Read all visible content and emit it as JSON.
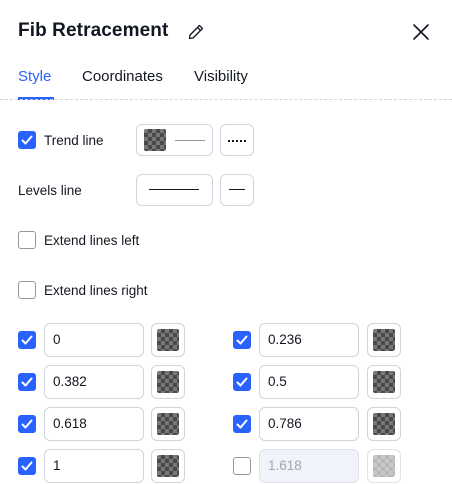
{
  "dialog": {
    "title": "Fib Retracement",
    "tabs": [
      {
        "label": "Style",
        "active": true
      },
      {
        "label": "Coordinates",
        "active": false
      },
      {
        "label": "Visibility",
        "active": false
      }
    ]
  },
  "style": {
    "trend_line": {
      "label": "Trend line",
      "checked": true,
      "color_icon": "checkerboard-swatch",
      "line_style": "solid",
      "line_dash": "dotted"
    },
    "levels_line": {
      "label": "Levels line",
      "line_style": "solid"
    },
    "extend_left": {
      "label": "Extend lines left",
      "checked": false
    },
    "extend_right": {
      "label": "Extend lines right",
      "checked": false
    },
    "levels": [
      {
        "value": "0",
        "checked": true,
        "enabled": true
      },
      {
        "value": "0.236",
        "checked": true,
        "enabled": true
      },
      {
        "value": "0.382",
        "checked": true,
        "enabled": true
      },
      {
        "value": "0.5",
        "checked": true,
        "enabled": true
      },
      {
        "value": "0.618",
        "checked": true,
        "enabled": true
      },
      {
        "value": "0.786",
        "checked": true,
        "enabled": true
      },
      {
        "value": "1",
        "checked": true,
        "enabled": true
      },
      {
        "value": "1.618",
        "checked": false,
        "enabled": false
      }
    ]
  },
  "colors": {
    "accent": "#2962ff",
    "border": "#d1d4dc",
    "text": "#131722"
  }
}
